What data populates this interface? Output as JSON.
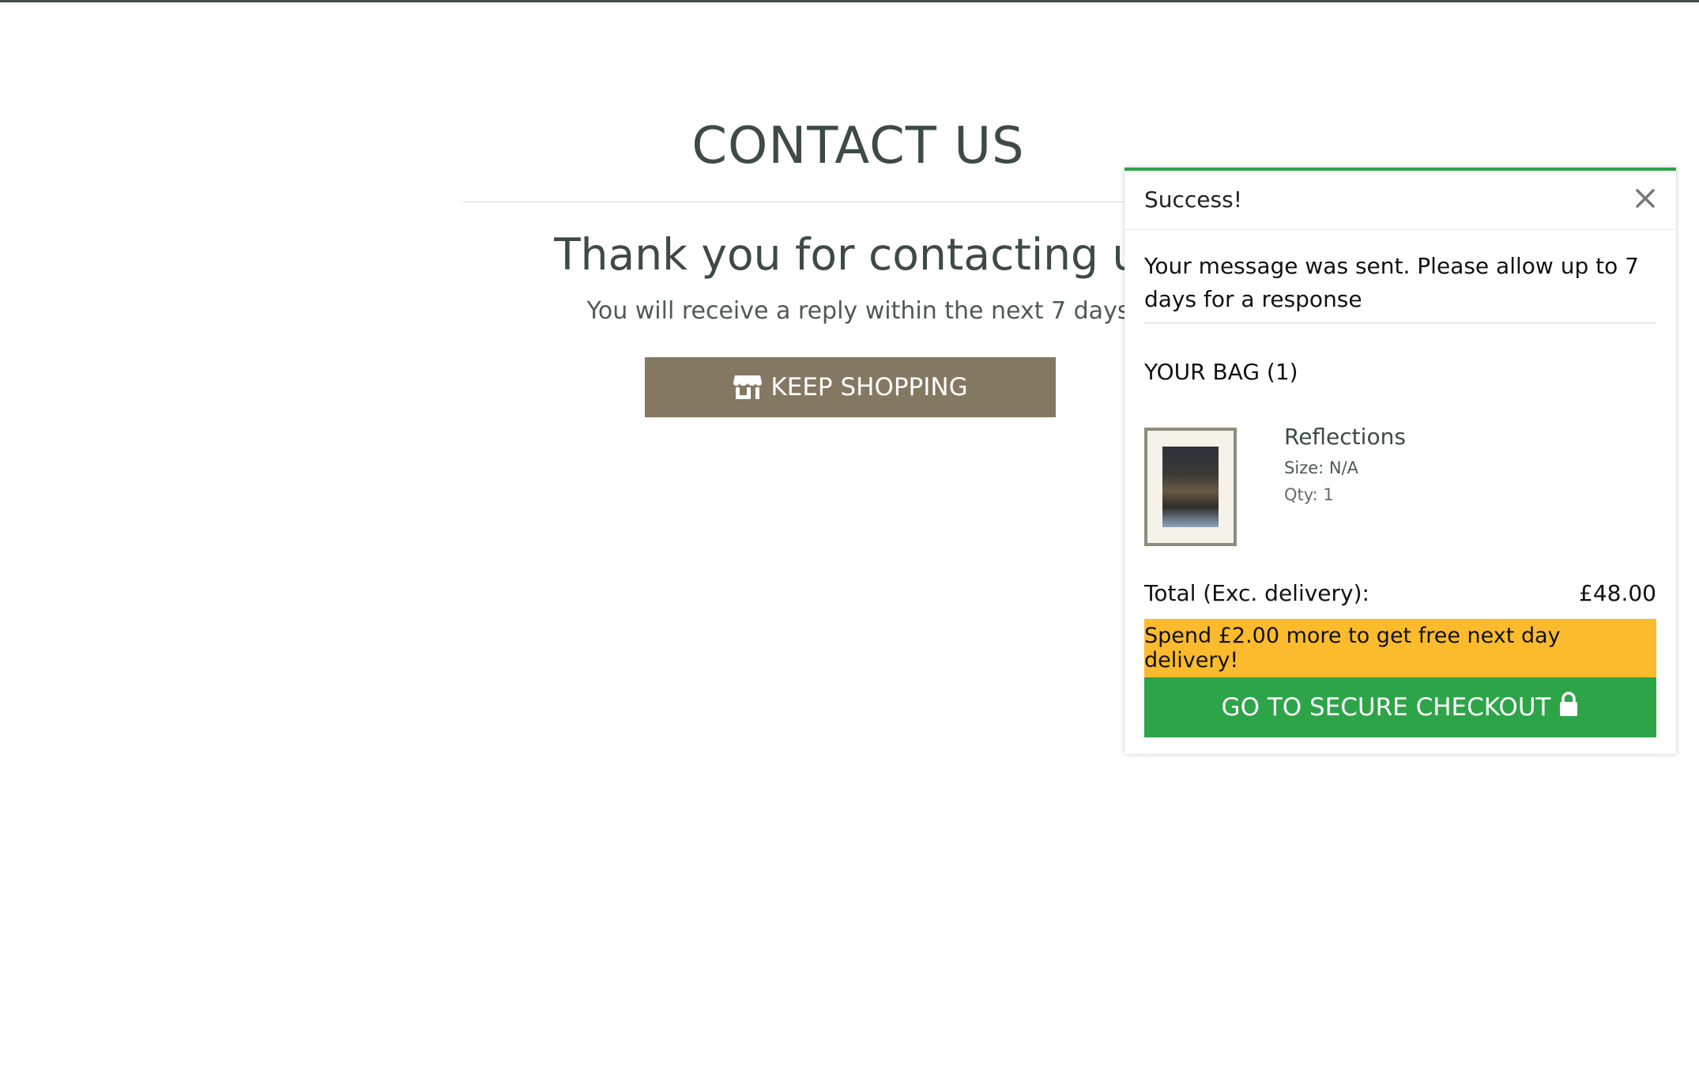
{
  "page": {
    "title": "CONTACT US",
    "heading": "Thank you for contacting us",
    "subtext": "You will receive a reply within the next 7 days",
    "keep_shopping_label": "KEEP SHOPPING",
    "keep_shopping_icon": "store-icon"
  },
  "popup": {
    "title": "Success!",
    "close_icon": "close-icon",
    "message": "Your message was sent. Please allow up to 7 days for a response",
    "bag_heading": "YOUR BAG (1)",
    "item": {
      "name": "Reflections",
      "size": "Size: N/A",
      "qty": "Qty: 1"
    },
    "total_label": "Total (Exc. delivery):",
    "total_value": "£48.00",
    "delivery_banner": "Spend £2.00 more to get free next day delivery!",
    "checkout_label": "GO TO SECURE CHECKOUT",
    "checkout_icon": "lock-icon"
  },
  "colors": {
    "accent_green": "#2ea449",
    "banner_yellow": "#fbbb2d",
    "button_brown": "#857862",
    "text_dark": "#3d4b44"
  }
}
